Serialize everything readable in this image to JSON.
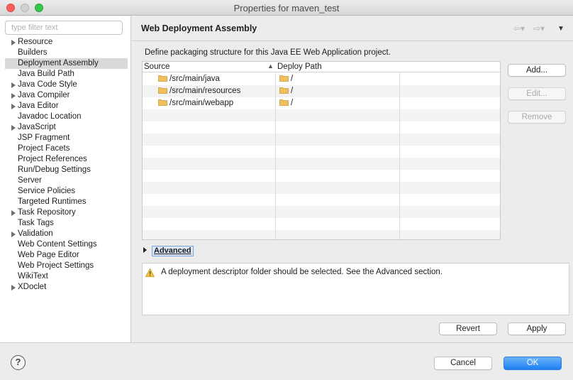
{
  "window": {
    "title": "Properties for maven_test"
  },
  "filter": {
    "placeholder": "type filter text"
  },
  "tree": [
    {
      "label": "Resource",
      "expandable": true
    },
    {
      "label": "Builders",
      "expandable": false
    },
    {
      "label": "Deployment Assembly",
      "expandable": false,
      "selected": true
    },
    {
      "label": "Java Build Path",
      "expandable": false
    },
    {
      "label": "Java Code Style",
      "expandable": true
    },
    {
      "label": "Java Compiler",
      "expandable": true
    },
    {
      "label": "Java Editor",
      "expandable": true
    },
    {
      "label": "Javadoc Location",
      "expandable": false
    },
    {
      "label": "JavaScript",
      "expandable": true
    },
    {
      "label": "JSP Fragment",
      "expandable": false
    },
    {
      "label": "Project Facets",
      "expandable": false
    },
    {
      "label": "Project References",
      "expandable": false
    },
    {
      "label": "Run/Debug Settings",
      "expandable": false
    },
    {
      "label": "Server",
      "expandable": false
    },
    {
      "label": "Service Policies",
      "expandable": false
    },
    {
      "label": "Targeted Runtimes",
      "expandable": false
    },
    {
      "label": "Task Repository",
      "expandable": true
    },
    {
      "label": "Task Tags",
      "expandable": false
    },
    {
      "label": "Validation",
      "expandable": true
    },
    {
      "label": "Web Content Settings",
      "expandable": false
    },
    {
      "label": "Web Page Editor",
      "expandable": false
    },
    {
      "label": "Web Project Settings",
      "expandable": false
    },
    {
      "label": "WikiText",
      "expandable": false
    },
    {
      "label": "XDoclet",
      "expandable": true
    }
  ],
  "page": {
    "title": "Web Deployment Assembly",
    "description": "Define packaging structure for this Java EE Web Application project."
  },
  "table": {
    "columns": [
      "Source",
      "Deploy Path"
    ],
    "rows": [
      {
        "source": "/src/main/java",
        "deploy": "/"
      },
      {
        "source": "/src/main/resources",
        "deploy": "/"
      },
      {
        "source": "/src/main/webapp",
        "deploy": "/"
      }
    ]
  },
  "side_buttons": {
    "add": "Add...",
    "edit": "Edit...",
    "remove": "Remove"
  },
  "advanced": {
    "label": "Advanced"
  },
  "message": {
    "text": "A deployment descriptor folder should be selected. See the Advanced section."
  },
  "actions": {
    "revert": "Revert",
    "apply": "Apply",
    "cancel": "Cancel",
    "ok": "OK"
  },
  "help": {
    "glyph": "?"
  },
  "colors": {
    "folder": "#f0c060",
    "warning": "#f5c342",
    "ok_button": "#1d80f2",
    "selected_row": "#d9d9d9"
  }
}
